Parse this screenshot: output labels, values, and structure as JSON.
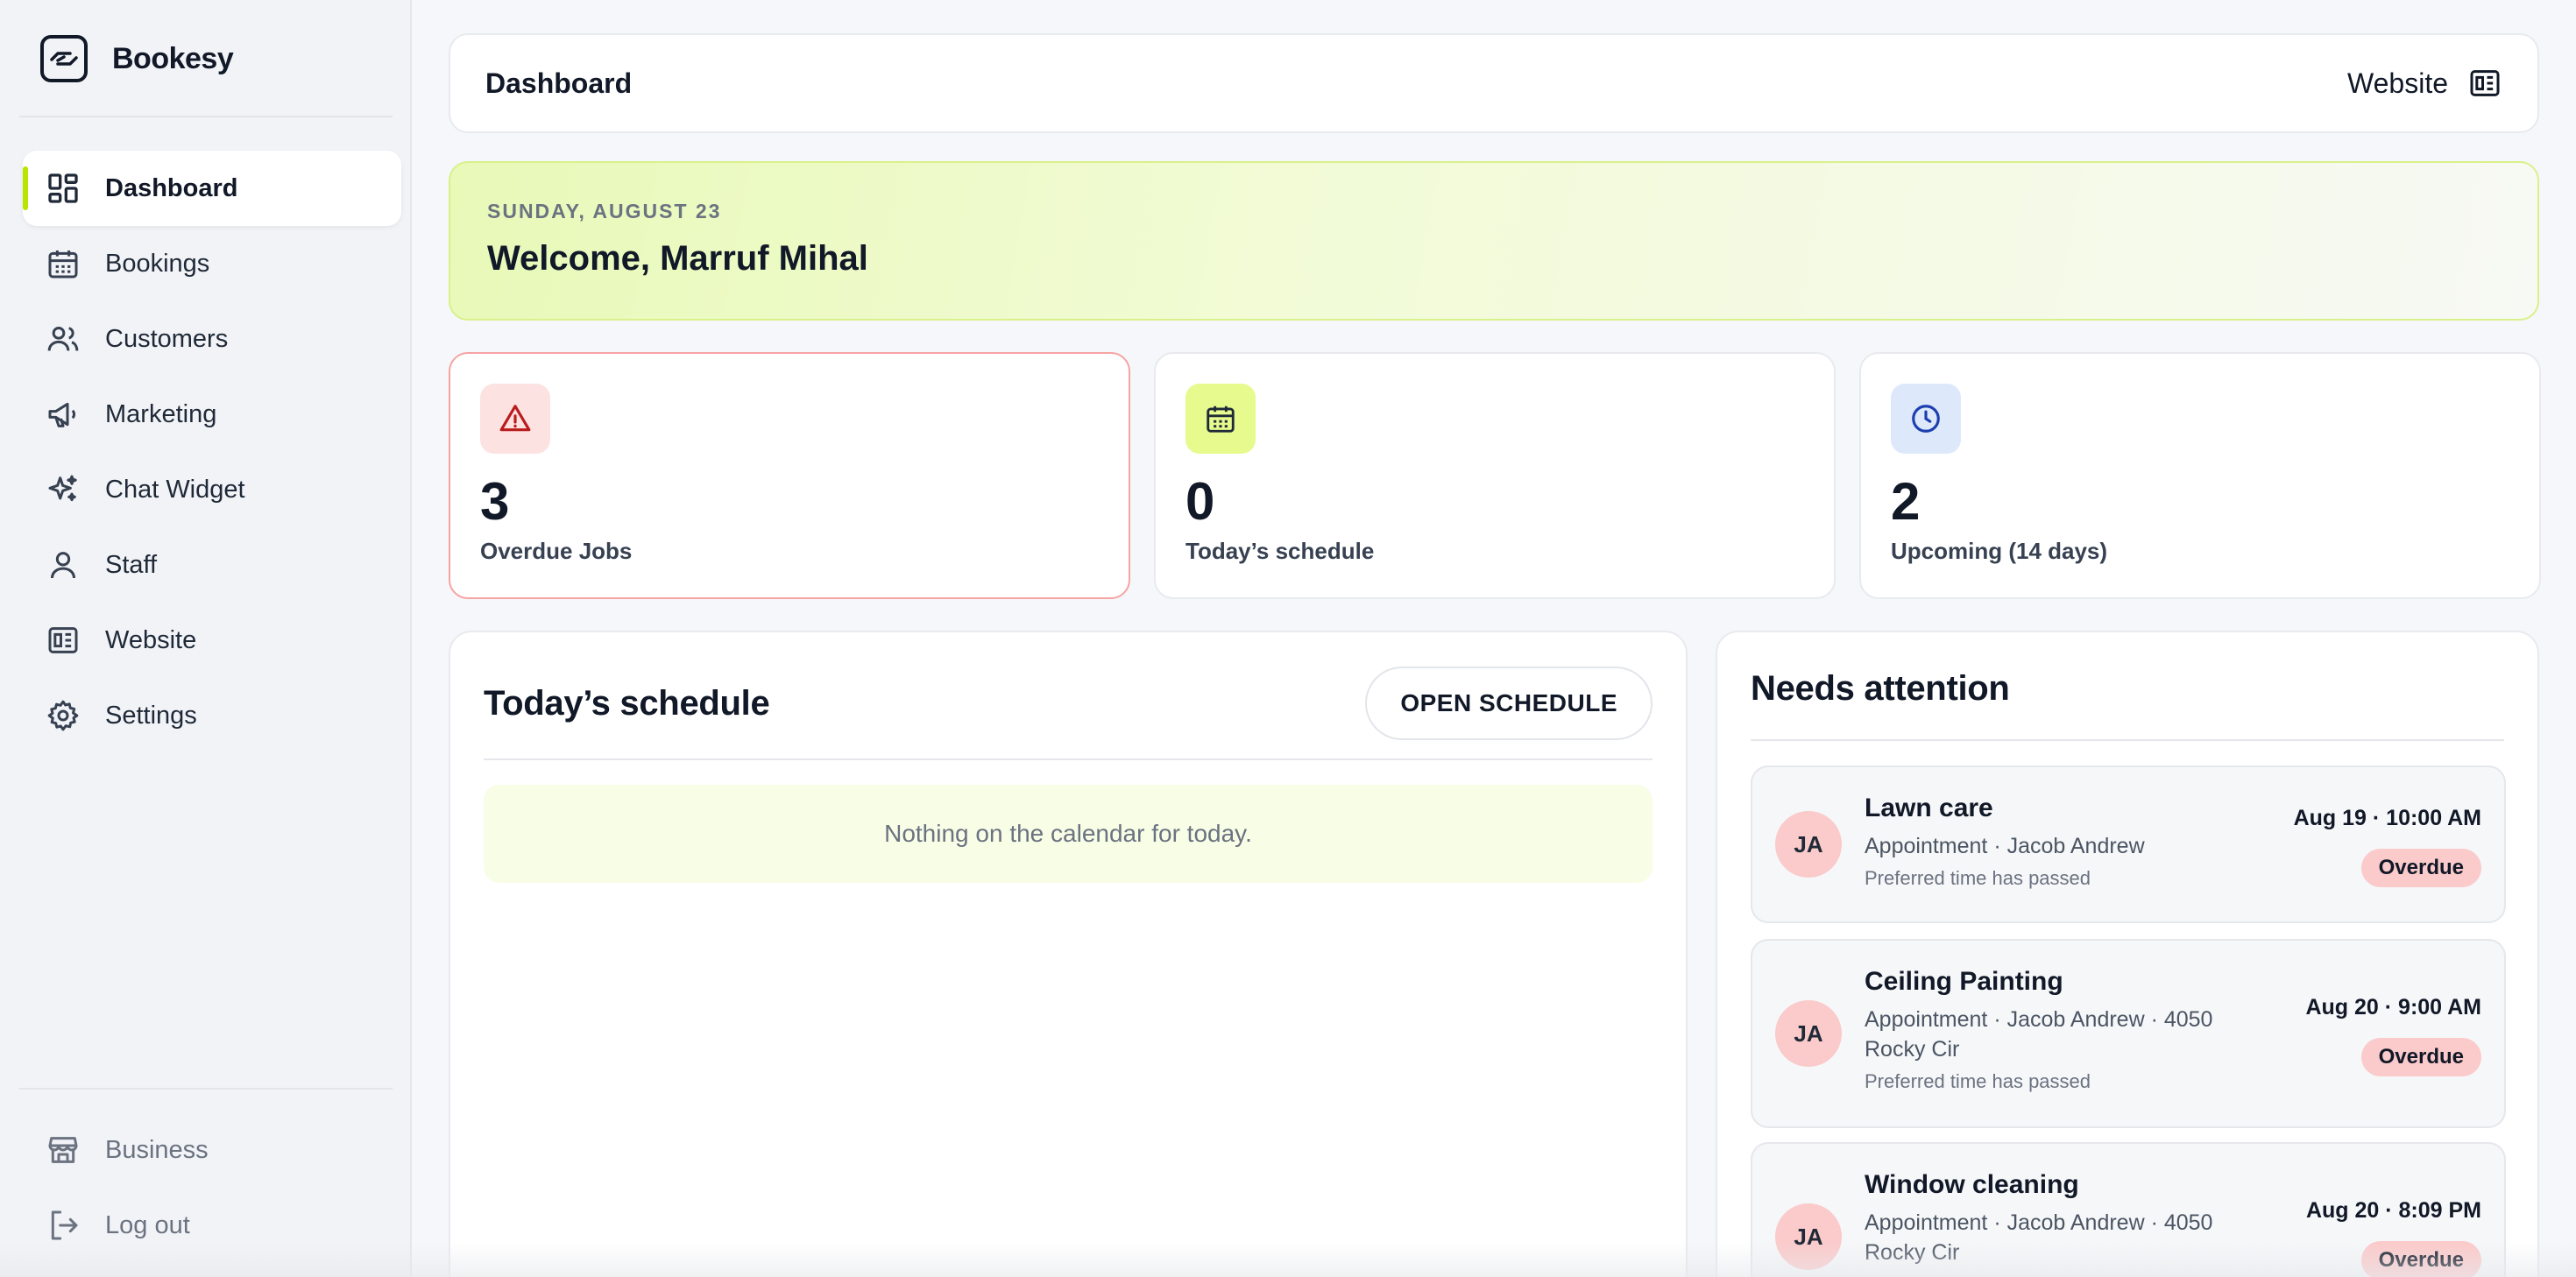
{
  "brand": {
    "name": "Bookesy"
  },
  "sidebar": {
    "items": [
      {
        "label": "Dashboard",
        "icon": "dashboard-icon",
        "active": true
      },
      {
        "label": "Bookings",
        "icon": "calendar-icon"
      },
      {
        "label": "Customers",
        "icon": "users-icon"
      },
      {
        "label": "Marketing",
        "icon": "megaphone-icon"
      },
      {
        "label": "Chat Widget",
        "icon": "sparkles-icon"
      },
      {
        "label": "Staff",
        "icon": "user-icon"
      },
      {
        "label": "Website",
        "icon": "website-icon"
      },
      {
        "label": "Settings",
        "icon": "gear-icon"
      }
    ],
    "bottom": [
      {
        "label": "Business",
        "icon": "store-icon"
      },
      {
        "label": "Log out",
        "icon": "logout-icon"
      }
    ]
  },
  "topbar": {
    "title": "Dashboard",
    "website_label": "Website"
  },
  "welcome": {
    "date": "SUNDAY, AUGUST 23",
    "title": "Welcome, Marruf Mihal"
  },
  "stats": [
    {
      "value": "3",
      "label": "Overdue Jobs",
      "icon": "alert-triangle-icon",
      "color": "#fde2e2"
    },
    {
      "value": "0",
      "label": "Today’s schedule",
      "icon": "calendar-icon",
      "color": "#e6fa8e"
    },
    {
      "value": "2",
      "label": "Upcoming (14 days)",
      "icon": "clock-icon",
      "color": "#dde9fb"
    }
  ],
  "schedule": {
    "title": "Today’s schedule",
    "button": "OPEN SCHEDULE",
    "empty": "Nothing on the calendar for today."
  },
  "attention": {
    "title": "Needs attention",
    "items": [
      {
        "initials": "JA",
        "title": "Lawn care",
        "desc": "Appointment · Jacob Andrew",
        "note": "Preferred time has passed",
        "time": "Aug 19 · 10:00 AM",
        "status": "Overdue"
      },
      {
        "initials": "JA",
        "title": "Ceiling Painting",
        "desc": "Appointment · Jacob Andrew · 4050 Rocky Cir",
        "note": "Preferred time has passed",
        "time": "Aug 20 · 9:00 AM",
        "status": "Overdue"
      },
      {
        "initials": "JA",
        "title": "Window cleaning",
        "desc": "Appointment · Jacob Andrew · 4050 Rocky Cir",
        "note": "",
        "time": "Aug 20 · 8:09 PM",
        "status": "Overdue"
      }
    ]
  },
  "colors": {
    "accent": "#b8e600",
    "danger_border": "#f6a3a3",
    "badge": "#fbcaca"
  }
}
